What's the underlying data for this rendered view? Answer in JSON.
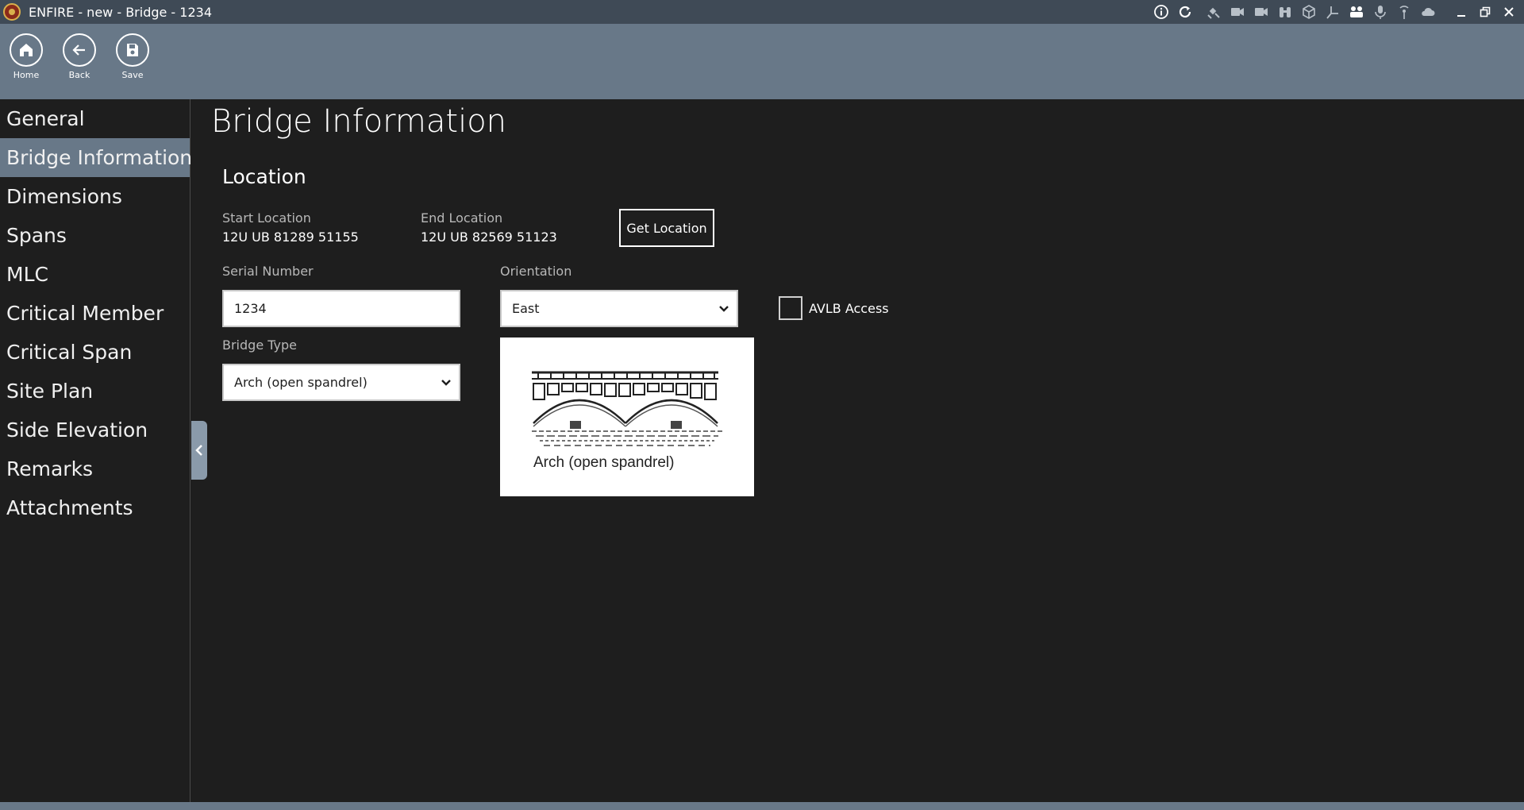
{
  "window": {
    "title": "ENFIRE - new - Bridge - 1234",
    "tray_icons": [
      "info-icon",
      "refresh-icon",
      "satellite-icon",
      "video-camera-icon",
      "video-camera-alt-icon",
      "binoculars-icon",
      "cube-icon",
      "axis-icon",
      "group-icon",
      "microphone-icon",
      "antenna-icon",
      "cloud-icon"
    ],
    "controls": [
      "minimize-icon",
      "restore-icon",
      "close-icon"
    ]
  },
  "toolbar": {
    "home_label": "Home",
    "back_label": "Back",
    "save_label": "Save"
  },
  "sidebar": {
    "items": [
      {
        "label": "General",
        "active": false
      },
      {
        "label": "Bridge Information",
        "active": true
      },
      {
        "label": "Dimensions",
        "active": false
      },
      {
        "label": "Spans",
        "active": false
      },
      {
        "label": "MLC",
        "active": false
      },
      {
        "label": "Critical Member",
        "active": false
      },
      {
        "label": "Critical Span",
        "active": false
      },
      {
        "label": "Site Plan",
        "active": false
      },
      {
        "label": "Side Elevation",
        "active": false
      },
      {
        "label": "Remarks",
        "active": false
      },
      {
        "label": "Attachments",
        "active": false
      }
    ]
  },
  "main": {
    "page_title": "Bridge Information",
    "location": {
      "section_title": "Location",
      "start_label": "Start Location",
      "start_value": "12U UB 81289 51155",
      "end_label": "End Location",
      "end_value": "12U UB 82569 51123",
      "get_location_label": "Get Location"
    },
    "serial_number": {
      "label": "Serial Number",
      "value": "1234"
    },
    "orientation": {
      "label": "Orientation",
      "value": "East"
    },
    "avlb": {
      "label": "AVLB Access",
      "checked": false
    },
    "bridge_type": {
      "label": "Bridge Type",
      "value": "Arch (open spandrel)"
    },
    "bridge_image_caption": "Arch (open spandrel)"
  },
  "colors": {
    "titlebar": "#3f4a56",
    "toolbar": "#687888",
    "background": "#1e1e1e",
    "active_nav": "#687888"
  }
}
